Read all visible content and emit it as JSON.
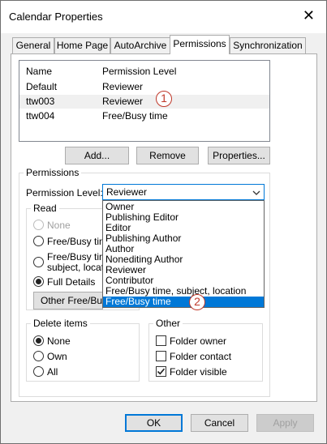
{
  "window": {
    "title": "Calendar Properties"
  },
  "tabs": [
    {
      "label": "General"
    },
    {
      "label": "Home Page"
    },
    {
      "label": "AutoArchive"
    },
    {
      "label": "Permissions"
    },
    {
      "label": "Synchronization"
    }
  ],
  "permissions_list": {
    "headers": [
      "Name",
      "Permission Level"
    ],
    "rows": [
      {
        "name": "Default",
        "level": "Reviewer"
      },
      {
        "name": "ttw003",
        "level": "Reviewer"
      },
      {
        "name": "ttw004",
        "level": "Free/Busy time"
      }
    ]
  },
  "list_buttons": {
    "add": "Add...",
    "remove": "Remove",
    "properties": "Properties..."
  },
  "permissions_group": {
    "title": "Permissions",
    "level_label": "Permission Level:",
    "level_value": "Reviewer"
  },
  "dropdown": {
    "options": [
      "Owner",
      "Publishing Editor",
      "Editor",
      "Publishing Author",
      "Author",
      "Nonediting Author",
      "Reviewer",
      "Contributor",
      "Free/Busy time, subject, location",
      "Free/Busy time"
    ]
  },
  "read_group": {
    "title": "Read",
    "none": "None",
    "freebusy": "Free/Busy tim",
    "freebusy_subject_1": "Free/Busy tim",
    "freebusy_subject_2": "subject, locatio",
    "full": "Full Details",
    "other_button": "Other Free/Bus"
  },
  "delete_group": {
    "title": "Delete items",
    "none": "None",
    "own": "Own",
    "all": "All"
  },
  "other_group": {
    "title": "Other",
    "folder_owner": "Folder owner",
    "folder_contact": "Folder contact",
    "folder_visible": "Folder visible"
  },
  "footer": {
    "ok": "OK",
    "cancel": "Cancel",
    "apply": "Apply"
  },
  "annotations": {
    "one": "1",
    "two": "2"
  }
}
